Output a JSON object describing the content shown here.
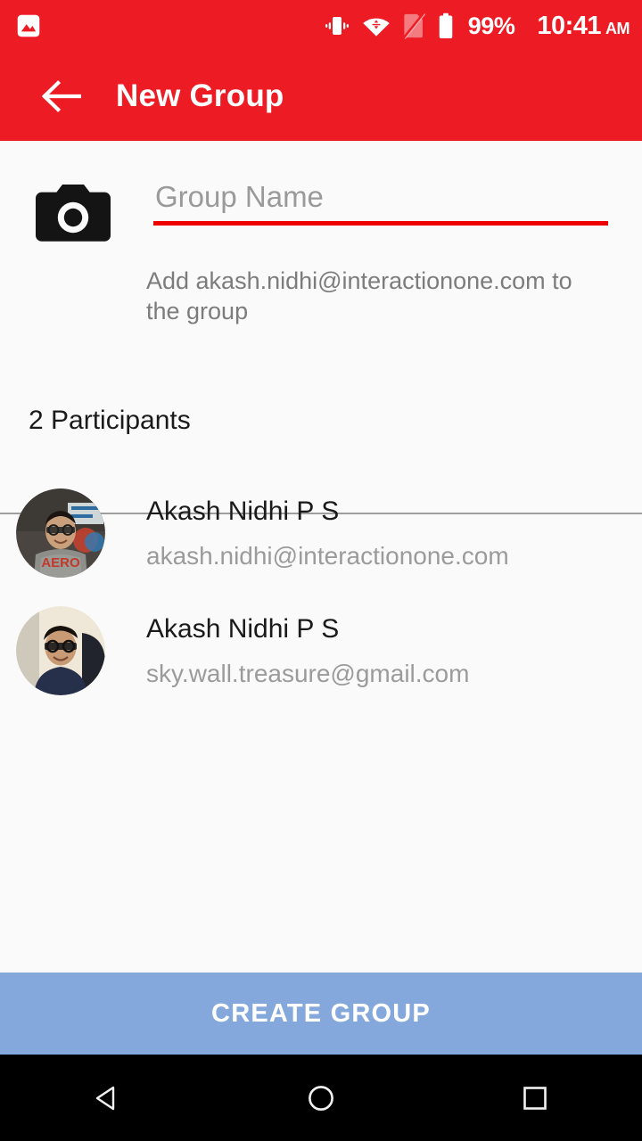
{
  "status_bar": {
    "icons": [
      "photo-icon",
      "vibrate-icon",
      "wifi-icon",
      "sim-disabled-icon",
      "battery-icon"
    ],
    "battery_percent": "99%",
    "time": "10:41",
    "meridiem": "AM",
    "background_color": "#ED1C24",
    "foreground_color": "#FFFFFF"
  },
  "app_bar": {
    "back_icon": "back-arrow-icon",
    "title": "New Group",
    "background_color": "#ED1C24"
  },
  "header": {
    "camera_icon": "camera-icon",
    "group_name_value": "",
    "group_name_placeholder": "Group Name",
    "underline_color": "#EE0000",
    "helper_text": "Add akash.nidhi@interactionone.com to the group"
  },
  "participants": {
    "count_label": "2 Participants",
    "items": [
      {
        "name": "Akash Nidhi P S",
        "email": "akash.nidhi@interactionone.com",
        "avatar": "avatar-photo-1"
      },
      {
        "name": "Akash Nidhi P S",
        "email": "sky.wall.treasure@gmail.com",
        "avatar": "avatar-photo-2"
      }
    ]
  },
  "footer": {
    "create_group_label": "CREATE GROUP",
    "create_group_color": "#85A8DC",
    "create_group_text_color": "#FFFFFF"
  },
  "nav_bar": {
    "back_label": "Back",
    "home_label": "Home",
    "recents_label": "Recents",
    "background_color": "#000000"
  }
}
